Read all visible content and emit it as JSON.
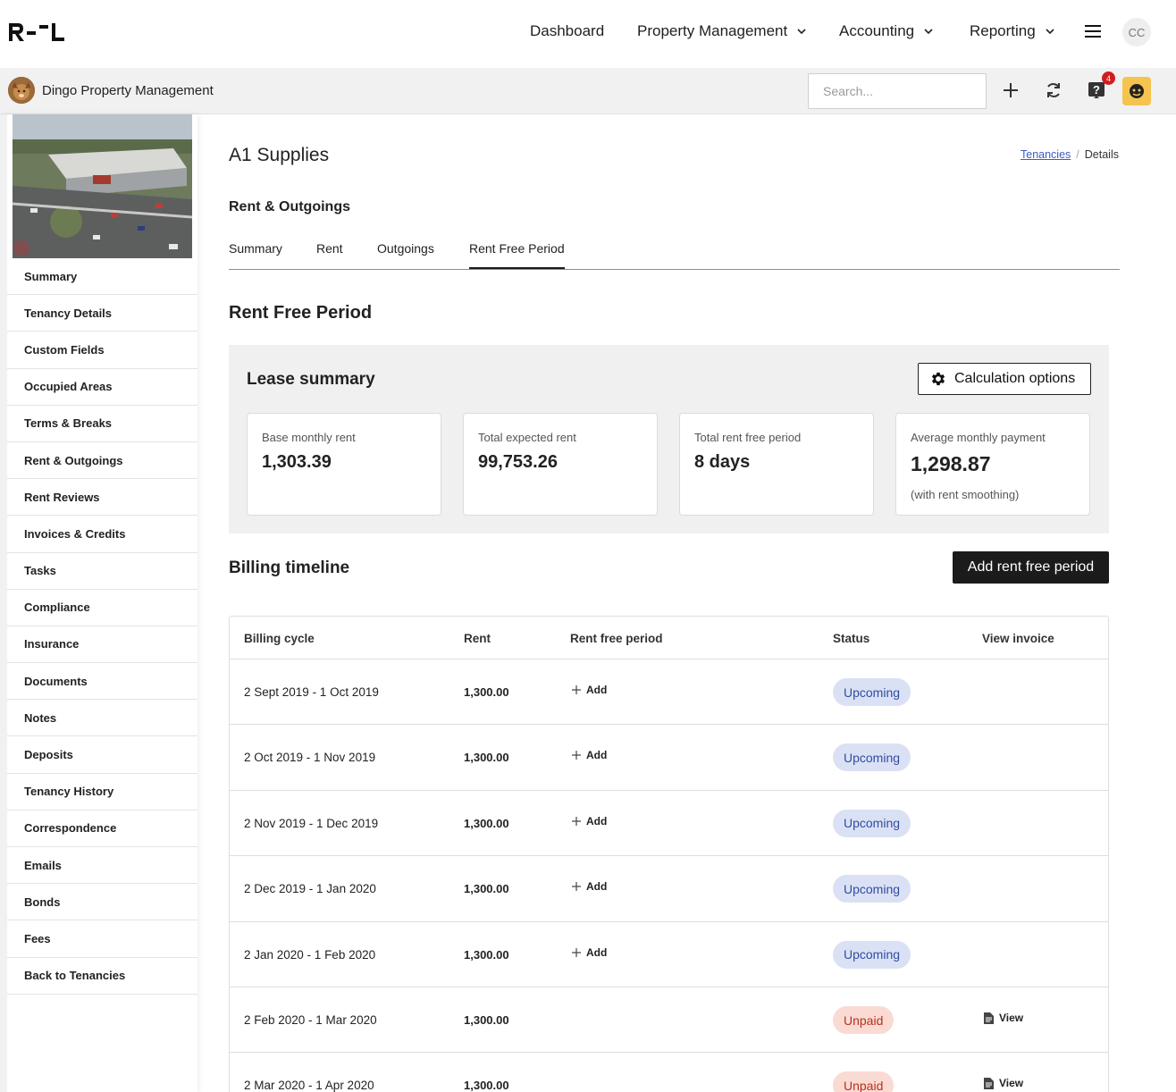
{
  "nav": {
    "logo_text": "R--L",
    "items": [
      {
        "label": "Dashboard",
        "dropdown": false
      },
      {
        "label": "Property Management",
        "dropdown": true
      },
      {
        "label": "Accounting",
        "dropdown": true
      },
      {
        "label": "Reporting",
        "dropdown": true
      }
    ],
    "user_initials": "CC"
  },
  "subbar": {
    "org_name": "Dingo Property Management",
    "search_placeholder": "Search...",
    "notification_count": "4"
  },
  "sidebar": {
    "items": [
      "Summary",
      "Tenancy Details",
      "Custom Fields",
      "Occupied Areas",
      "Terms & Breaks",
      "Rent & Outgoings",
      "Rent Reviews",
      "Invoices & Credits",
      "Tasks",
      "Compliance",
      "Insurance",
      "Documents",
      "Notes",
      "Deposits",
      "Tenancy History",
      "Correspondence",
      "Emails",
      "Bonds",
      "Fees",
      "Back to Tenancies"
    ]
  },
  "page": {
    "title": "A1 Supplies",
    "breadcrumb": {
      "link": "Tenancies",
      "current": "Details"
    },
    "section_title": "Rent & Outgoings",
    "tabs": [
      "Summary",
      "Rent",
      "Outgoings",
      "Rent Free Period"
    ],
    "active_tab": "Rent Free Period",
    "heading": "Rent Free Period"
  },
  "lease_summary": {
    "title": "Lease summary",
    "calc_button": "Calculation options",
    "cards": [
      {
        "label": "Base monthly rent",
        "value": "1,303.39",
        "sub": ""
      },
      {
        "label": "Total expected rent",
        "value": "99,753.26",
        "sub": ""
      },
      {
        "label": "Total rent free period",
        "value": "8 days",
        "sub": ""
      },
      {
        "label": "Average monthly payment",
        "value": "1,298.87",
        "sub": "(with rent smoothing)"
      }
    ]
  },
  "billing": {
    "title": "Billing timeline",
    "add_button": "Add rent free period",
    "columns": [
      "Billing cycle",
      "Rent",
      "Rent free period",
      "Status",
      "View invoice"
    ],
    "rows": [
      {
        "cycle": "2 Sept 2019 - 1 Oct 2019",
        "rent": "1,300.00",
        "rfp": "Add",
        "status": "Upcoming",
        "view": ""
      },
      {
        "cycle": "2 Oct 2019 - 1 Nov 2019",
        "rent": "1,300.00",
        "rfp": "Add",
        "status": "Upcoming",
        "view": ""
      },
      {
        "cycle": "2 Nov 2019 - 1 Dec 2019",
        "rent": "1,300.00",
        "rfp": "Add",
        "status": "Upcoming",
        "view": ""
      },
      {
        "cycle": "2 Dec 2019 - 1 Jan 2020",
        "rent": "1,300.00",
        "rfp": "Add",
        "status": "Upcoming",
        "view": ""
      },
      {
        "cycle": "2 Jan 2020 - 1 Feb 2020",
        "rent": "1,300.00",
        "rfp": "Add",
        "status": "Upcoming",
        "view": ""
      },
      {
        "cycle": "2 Feb 2020 - 1 Mar 2020",
        "rent": "1,300.00",
        "rfp": "",
        "status": "Unpaid",
        "view": "View"
      },
      {
        "cycle": "2 Mar 2020 - 1 Apr 2020",
        "rent": "1,300.00",
        "rfp": "",
        "status": "Unpaid",
        "view": "View"
      }
    ]
  },
  "colors": {
    "upcoming_bg": "#dbe1f4",
    "upcoming_text": "#2f4da3",
    "unpaid_bg": "#fadbd4",
    "unpaid_text": "#b9301a",
    "badge": "#d21d1d",
    "user_chip": "#f5c44e"
  }
}
